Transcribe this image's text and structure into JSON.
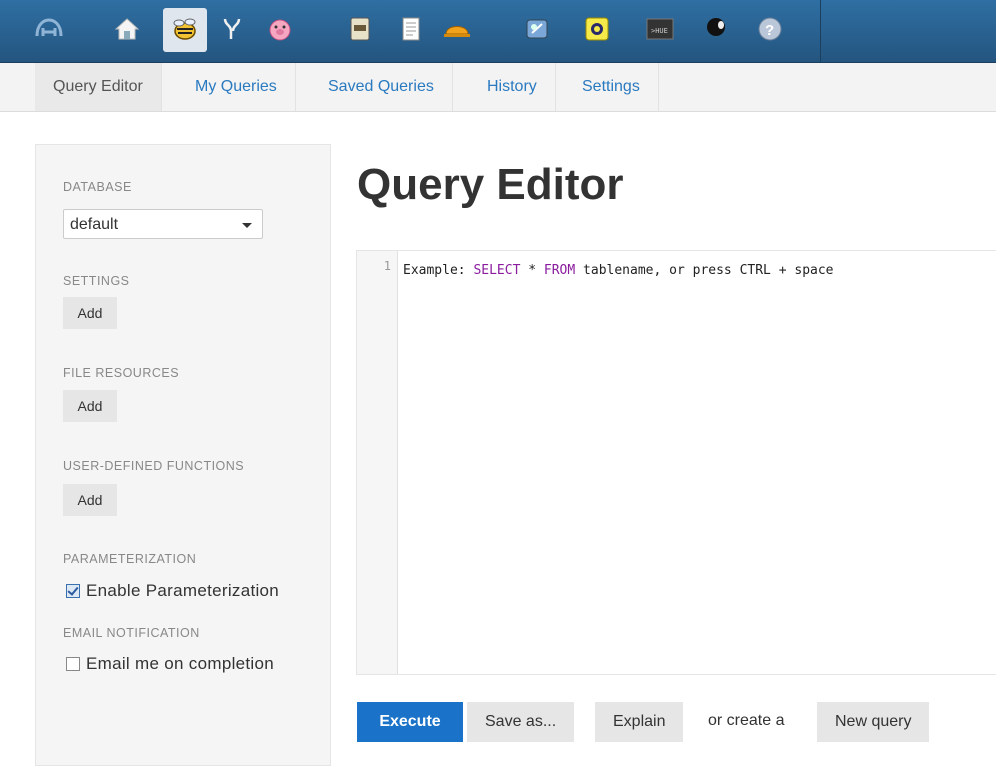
{
  "appbar": {
    "icons": [
      "hue-logo-icon",
      "home-icon",
      "beeswax-icon",
      "metastore-icon",
      "pig-icon",
      "file-browser-icon",
      "job-browser-icon",
      "hard-hat-icon",
      "oozie-icon",
      "sqoop-icon",
      "shell-icon",
      "user-admin-icon",
      "help-icon"
    ]
  },
  "subnav": {
    "tabs": [
      {
        "label": "Query Editor"
      },
      {
        "label": "My Queries"
      },
      {
        "label": "Saved Queries"
      },
      {
        "label": "History"
      },
      {
        "label": "Settings"
      }
    ]
  },
  "sidebar": {
    "database_label": "DATABASE",
    "database_value": "default",
    "settings_label": "SETTINGS",
    "settings_add": "Add",
    "file_resources_label": "FILE RESOURCES",
    "file_resources_add": "Add",
    "udf_label": "USER-DEFINED FUNCTIONS",
    "udf_add": "Add",
    "parameterization_label": "PARAMETERIZATION",
    "parameterization_checkbox": "Enable Parameterization",
    "email_label": "EMAIL NOTIFICATION",
    "email_checkbox": "Email me on completion"
  },
  "main": {
    "title": "Query Editor",
    "line_number": "1",
    "code_prefix": "Example: ",
    "code_kw1": "SELECT",
    "code_mid": " * ",
    "code_kw2": "FROM",
    "code_suffix": " tablename, or press CTRL + space"
  },
  "actions": {
    "execute": "Execute",
    "save_as": "Save as...",
    "explain": "Explain",
    "or_create": "or create a",
    "new_query": "New query"
  },
  "colors": {
    "appbar": "#2a6496",
    "link": "#2a7ac0",
    "primary": "#1a73c8"
  }
}
